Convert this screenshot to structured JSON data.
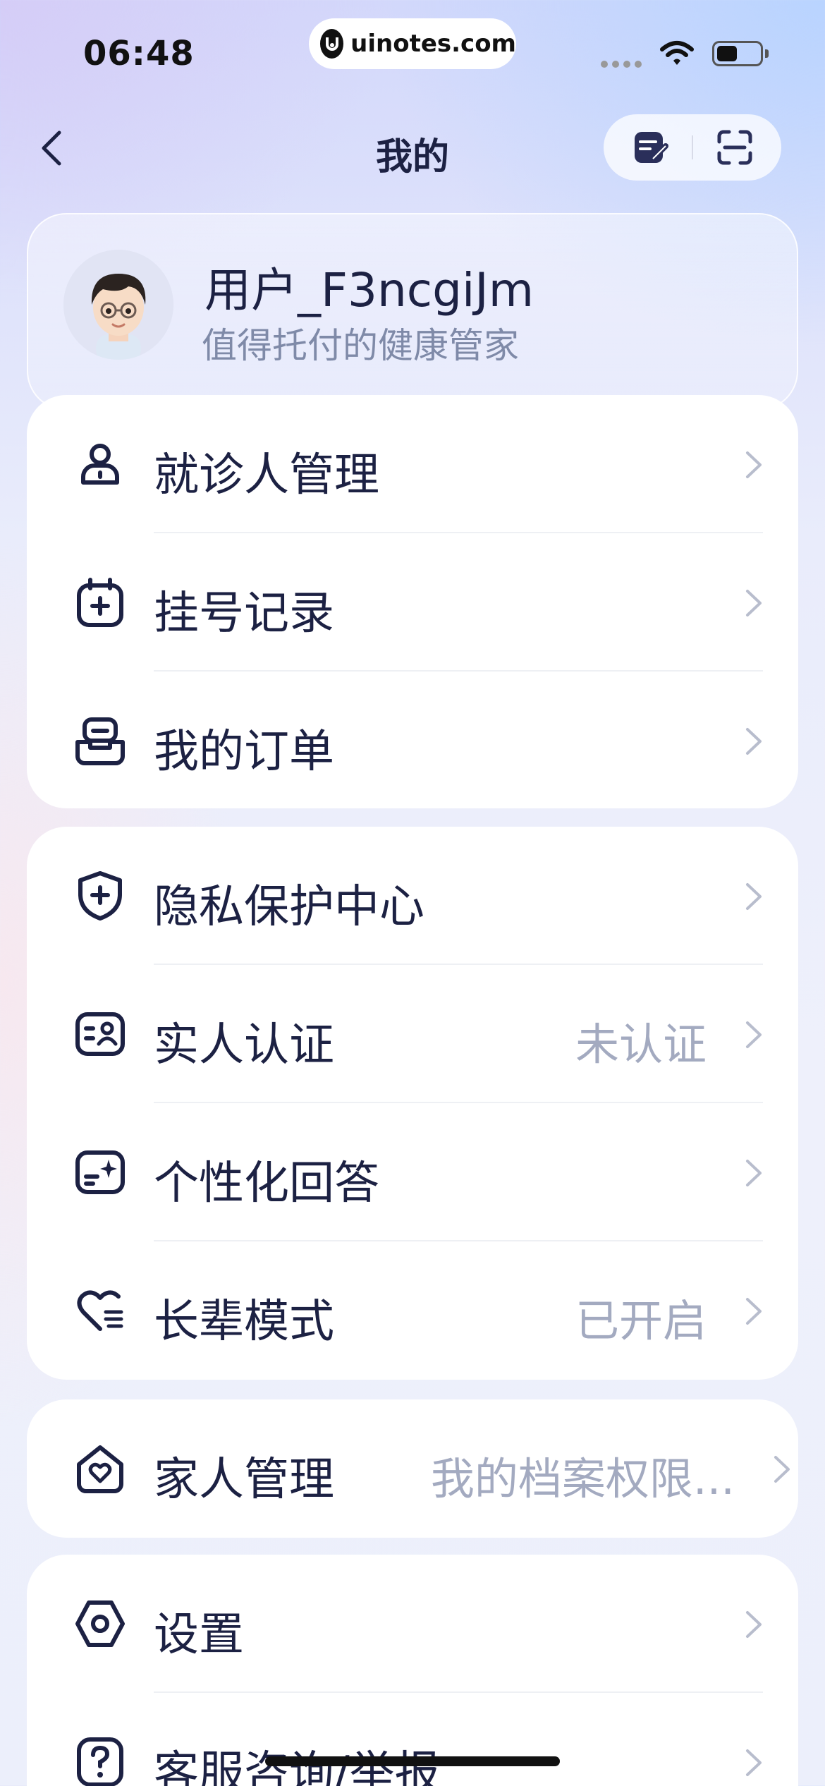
{
  "status": {
    "time": "06:48",
    "url": "uinotes.com"
  },
  "nav": {
    "title": "我的"
  },
  "profile": {
    "username": "用户_F3ncgiJm",
    "slogan": "值得托付的健康管家"
  },
  "groups": [
    {
      "items": [
        {
          "icon": "person-icon",
          "label": "就诊人管理",
          "value": ""
        },
        {
          "icon": "calendar-plus-icon",
          "label": "挂号记录",
          "value": ""
        },
        {
          "icon": "order-box-icon",
          "label": "我的订单",
          "value": ""
        }
      ]
    },
    {
      "items": [
        {
          "icon": "shield-plus-icon",
          "label": "隐私保护中心",
          "value": ""
        },
        {
          "icon": "id-card-icon",
          "label": "实人认证",
          "value": "未认证"
        },
        {
          "icon": "sparkle-note-icon",
          "label": "个性化回答",
          "value": ""
        },
        {
          "icon": "heart-lines-icon",
          "label": "长辈模式",
          "value": "已开启"
        }
      ]
    },
    {
      "items": [
        {
          "icon": "home-heart-icon",
          "label": "家人管理",
          "value": "我的档案权限..."
        }
      ]
    },
    {
      "items": [
        {
          "icon": "settings-hexagon-icon",
          "label": "设置",
          "value": ""
        },
        {
          "icon": "help-icon",
          "label": "客服咨询/举报",
          "value": ""
        }
      ]
    }
  ],
  "colors": {
    "text_primary": "#1c2143",
    "text_secondary": "#a3aac0",
    "card_background": "#ffffff"
  }
}
